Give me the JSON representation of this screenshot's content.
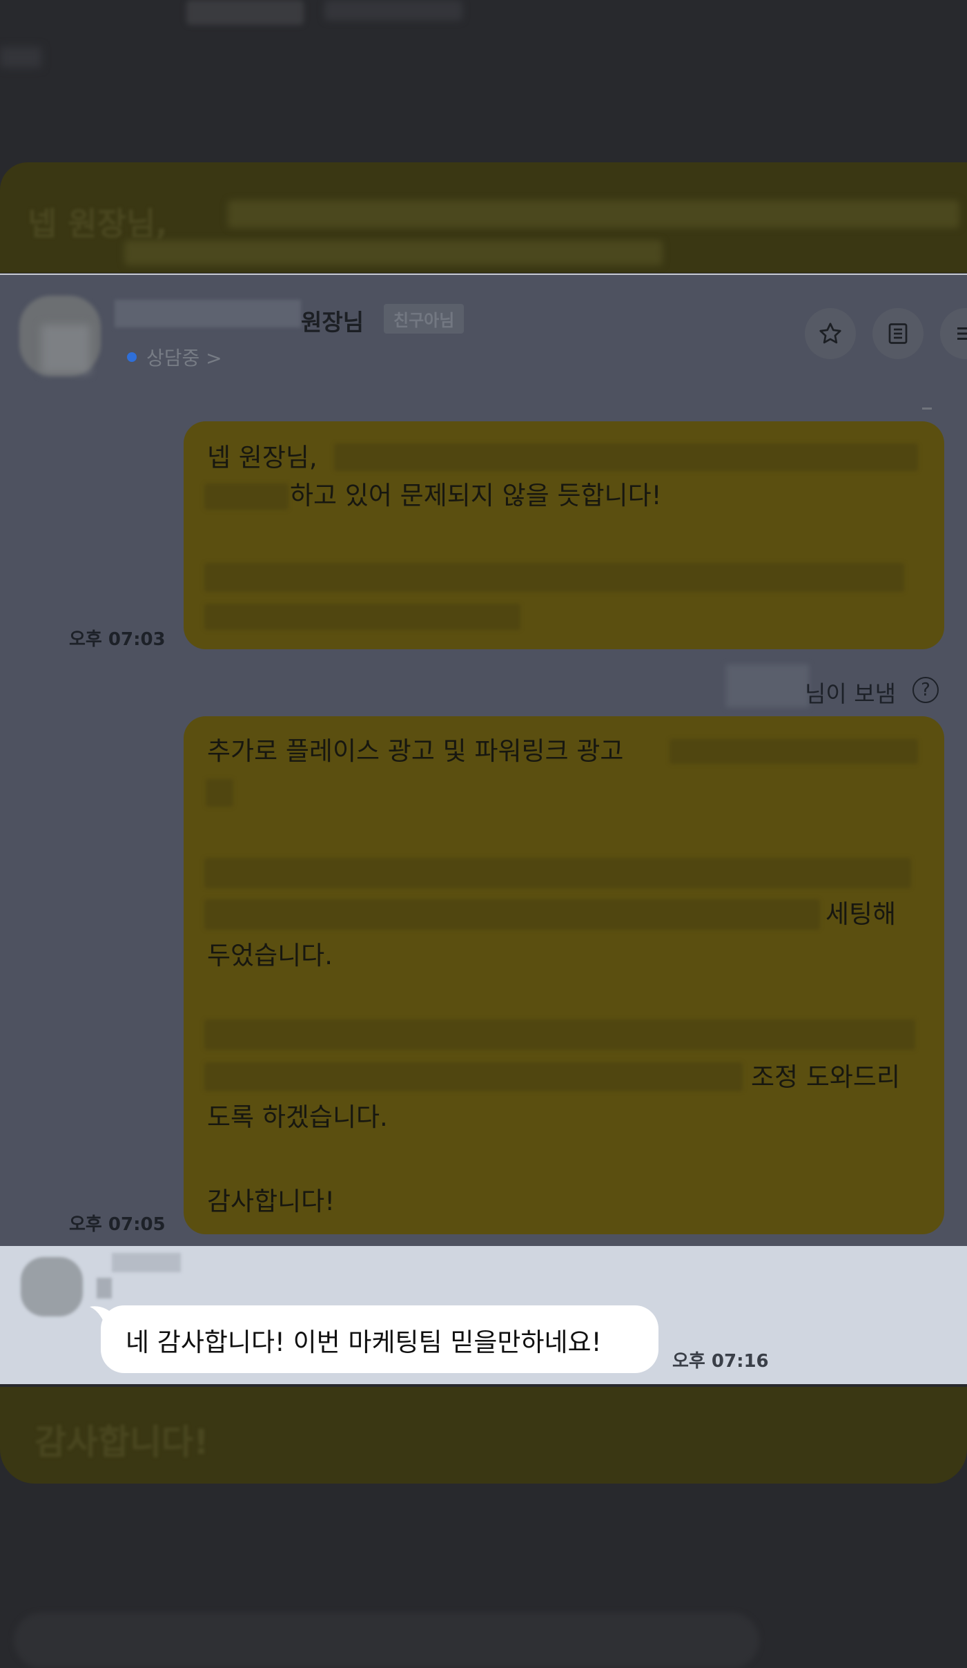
{
  "chat": {
    "header": {
      "name_suffix": "원장님",
      "friend_badge": "친구아님",
      "status": "상담중 >",
      "icons": [
        "star-icon",
        "notes-icon",
        "menu-icon"
      ]
    },
    "messages": [
      {
        "line1_prefix": "넵 원장님,",
        "line2_suffix": "하고 있어 문제되지 않을 듯합니다!",
        "time": "오후 07:03"
      },
      {
        "sender_suffix": "님이 보냄",
        "help_glyph": "?",
        "line1_prefix": "추가로 플레이스 광고 및 파워링크 광고",
        "line4_suffix": "세팅해",
        "line5": "두었습니다.",
        "line7_suffix": "조정 도와드리",
        "line8": "도록 하겠습니다.",
        "line10": "감사합니다!",
        "time": "오후 07:05"
      },
      {
        "text": "네 감사합니다! 이번 마케팅팀 믿을만하네요!",
        "time": "오후 07:16"
      }
    ]
  },
  "colors": {
    "accent_yellow": "#fee500",
    "status_dot": "#2f6fd8",
    "dim_overlay": "#28292d"
  }
}
